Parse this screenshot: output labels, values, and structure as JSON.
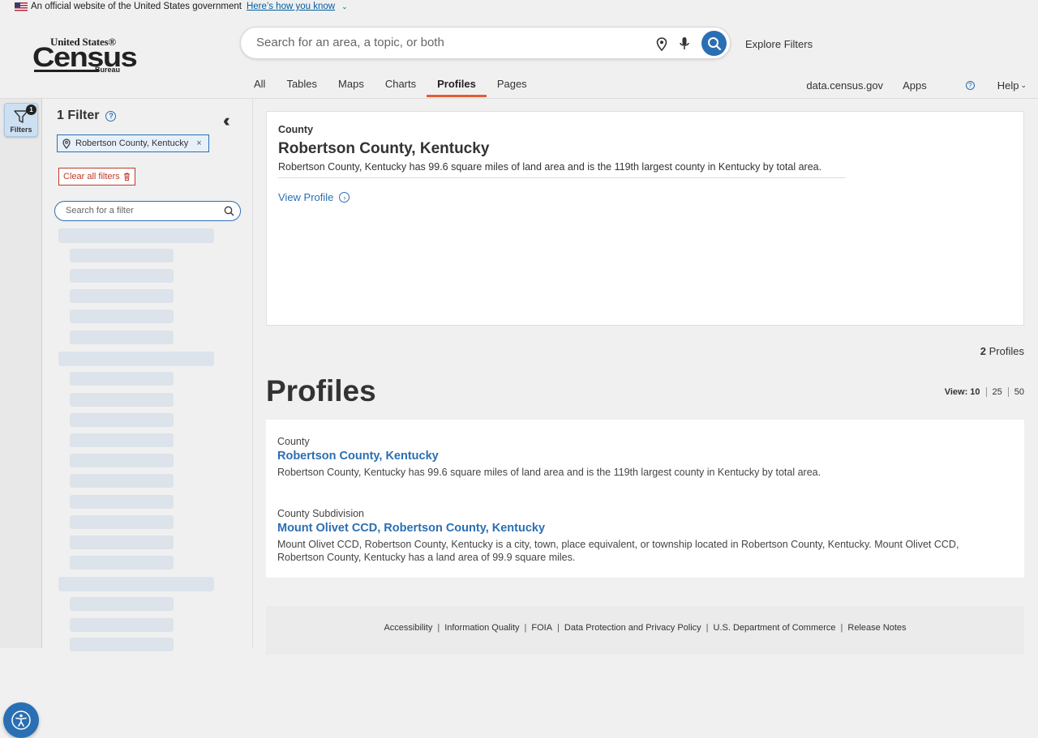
{
  "banner": {
    "text": "An official website of the United States government",
    "link": "Here’s how you know"
  },
  "logo": {
    "top": "United States®",
    "main": "Census",
    "sub": "Bureau"
  },
  "search": {
    "placeholder": "Search for an area, a topic, or both"
  },
  "header": {
    "explore": "Explore Filters",
    "tabs": [
      "All",
      "Tables",
      "Maps",
      "Charts",
      "Profiles",
      "Pages"
    ],
    "active_tab": "Profiles",
    "right_links": {
      "data": "data.census.gov",
      "apps": "Apps",
      "help": "Help"
    }
  },
  "rail": {
    "filters_label": "Filters",
    "badge": "1"
  },
  "filter_panel": {
    "title": "1 Filter",
    "chip": "Robertson County, Kentucky",
    "clear": "Clear all filters",
    "search_placeholder": "Search for a filter"
  },
  "feature": {
    "kicker": "County",
    "title": "Robertson County, Kentucky",
    "desc": "Robertson County, Kentucky has 99.6 square miles of land area and is the 119th largest county in Kentucky by total area.",
    "view": "View Profile"
  },
  "results_meta": {
    "count": "2",
    "count_label": "Profiles",
    "heading": "Profiles",
    "view_label": "View:",
    "view_options": [
      "10",
      "25",
      "50"
    ],
    "view_selected": "10"
  },
  "results": [
    {
      "kind": "County",
      "name": "Robertson County, Kentucky",
      "text": "Robertson County, Kentucky has 99.6 square miles of land area and is the 119th largest county in Kentucky by total area."
    },
    {
      "kind": "County Subdivision",
      "name": "Mount Olivet CCD, Robertson County, Kentucky",
      "text": "Mount Olivet CCD, Robertson County, Kentucky is a city, town, place equivalent, or township located in Robertson County, Kentucky. Mount Olivet CCD, Robertson County, Kentucky has a land area of 99.9 square miles."
    }
  ],
  "footer": {
    "links": [
      "Accessibility",
      "Information Quality",
      "FOIA",
      "Data Protection and Privacy Policy",
      "U.S. Department of Commerce",
      "Release Notes"
    ]
  },
  "colors": {
    "accent": "#2a6fb4",
    "active_tab_underline": "#e25d33",
    "clear_red": "#c0392b"
  }
}
